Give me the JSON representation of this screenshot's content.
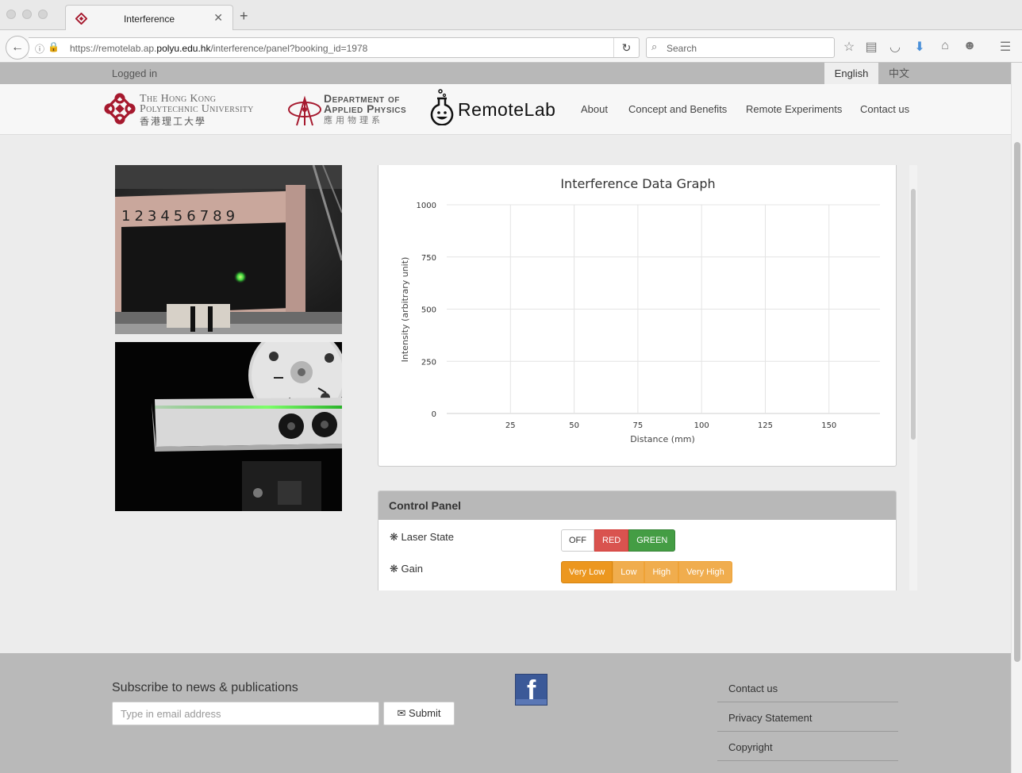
{
  "browser": {
    "tab_title": "Interference",
    "url_prefix": "https://remotelab.ap.",
    "url_domain": "polyu.edu.hk",
    "url_suffix": "/interference/panel?booking_id=1978",
    "search_placeholder": "Search"
  },
  "topbar": {
    "status": "Logged in",
    "lang_english": "English",
    "lang_chinese": "中文"
  },
  "header": {
    "polyu_line1": "The Hong Kong",
    "polyu_line2": "Polytechnic University",
    "polyu_line3": "香港理工大學",
    "dept_line1": "Department of",
    "dept_line2": "Applied Physics",
    "dept_line3": "應用物理系",
    "brand": "RemoteLab",
    "nav": [
      "About",
      "Concept and Benefits",
      "Remote Experiments",
      "Contact us"
    ]
  },
  "chart_data": {
    "type": "line",
    "title": "Interference Data Graph",
    "xlabel": "Distance (mm)",
    "ylabel": "Intensity (arbitrary unit)",
    "xlim": [
      0,
      170
    ],
    "ylim": [
      0,
      1000
    ],
    "x_ticks": [
      25,
      50,
      75,
      100,
      125,
      150
    ],
    "y_ticks": [
      0,
      250,
      500,
      750,
      1000
    ],
    "grid": true,
    "series": []
  },
  "control_panel": {
    "title": "Control Panel",
    "laser_label": "Laser State",
    "laser_options": [
      "OFF",
      "RED",
      "GREEN"
    ],
    "gain_label": "Gain",
    "gain_options": [
      "Very Low",
      "Low",
      "High",
      "Very High"
    ],
    "gain_selected": "Very Low"
  },
  "footer": {
    "subscribe_title": "Subscribe to news & publications",
    "email_placeholder": "Type in email address",
    "submit_label": "Submit",
    "links": [
      "Contact us",
      "Privacy Statement",
      "Copyright"
    ]
  },
  "colors": {
    "accent_red": "#d9534f",
    "accent_green": "#449d44",
    "accent_orange": "#f0ad4e",
    "polyu_red": "#a6192e"
  }
}
